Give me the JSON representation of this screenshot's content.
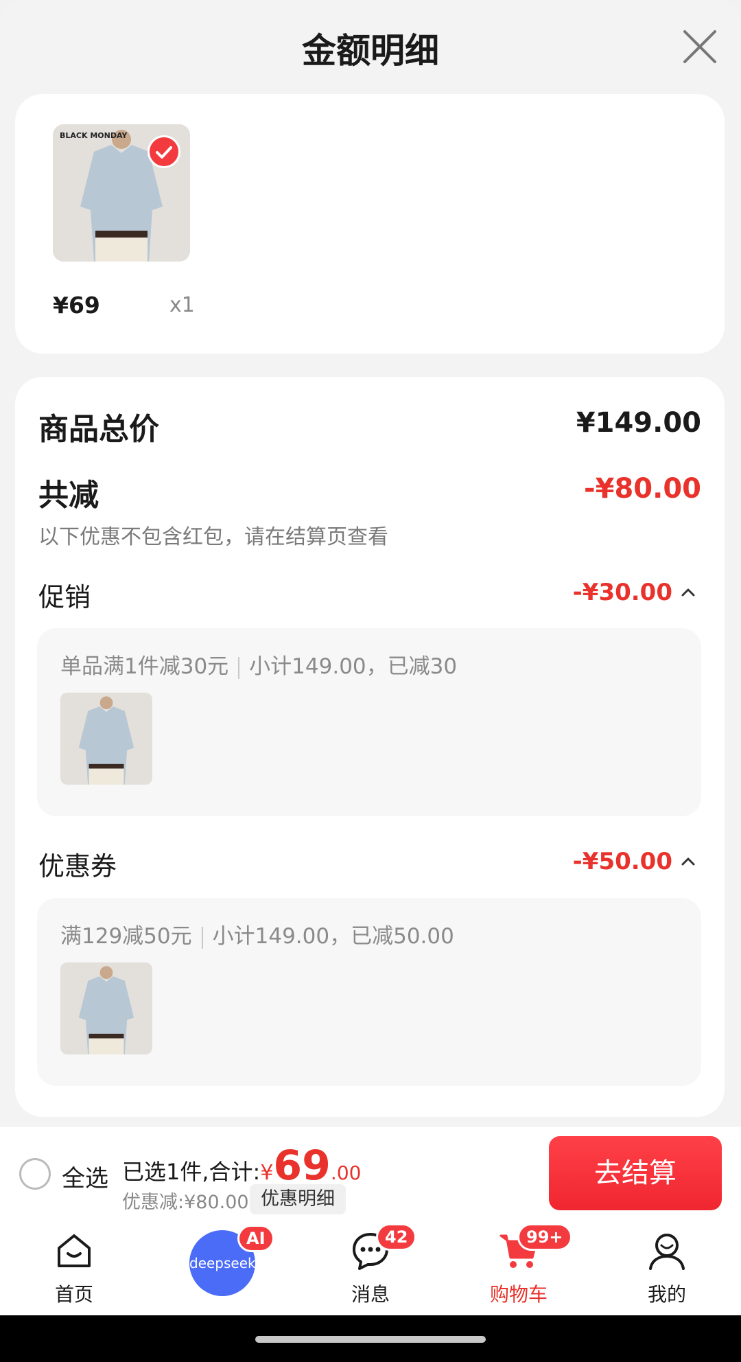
{
  "header": {
    "title": "金额明细"
  },
  "product": {
    "price": "¥69",
    "qty": "x1",
    "image_text": "BLACK MONDAY"
  },
  "details": {
    "total_label": "商品总价",
    "total_value": "¥149.00",
    "reduce_label": "共减",
    "reduce_value": "-¥80.00",
    "reduce_note": "以下优惠不包含红包，请在结算页查看",
    "promo": {
      "label": "促销",
      "value": "-¥30.00",
      "rule": "单品满1件减30元",
      "subtotal": "小计149.00，已减30"
    },
    "coupon": {
      "label": "优惠券",
      "value": "-¥50.00",
      "rule": "满129减50元",
      "subtotal": "小计149.00，已减50.00"
    }
  },
  "bottom": {
    "select_all": "全选",
    "selected_prefix": "已选1件,合计:",
    "currency": "¥",
    "amount_int": "69",
    "amount_dec": ".00",
    "discount": "优惠减:¥80.00",
    "detail_btn": "优惠明细",
    "checkout": "去结算"
  },
  "tabs": [
    {
      "label": "首页",
      "icon": "home-icon"
    },
    {
      "label": "deepseek",
      "icon": "deepseek-icon",
      "badge": "AI"
    },
    {
      "label": "消息",
      "icon": "message-icon",
      "badge": "42"
    },
    {
      "label": "购物车",
      "icon": "cart-icon",
      "badge": "99+",
      "active": true
    },
    {
      "label": "我的",
      "icon": "user-icon"
    }
  ],
  "colors": {
    "accent": "#e8322b",
    "checkout": "#f0262f",
    "deepseek": "#4a6cf7"
  }
}
